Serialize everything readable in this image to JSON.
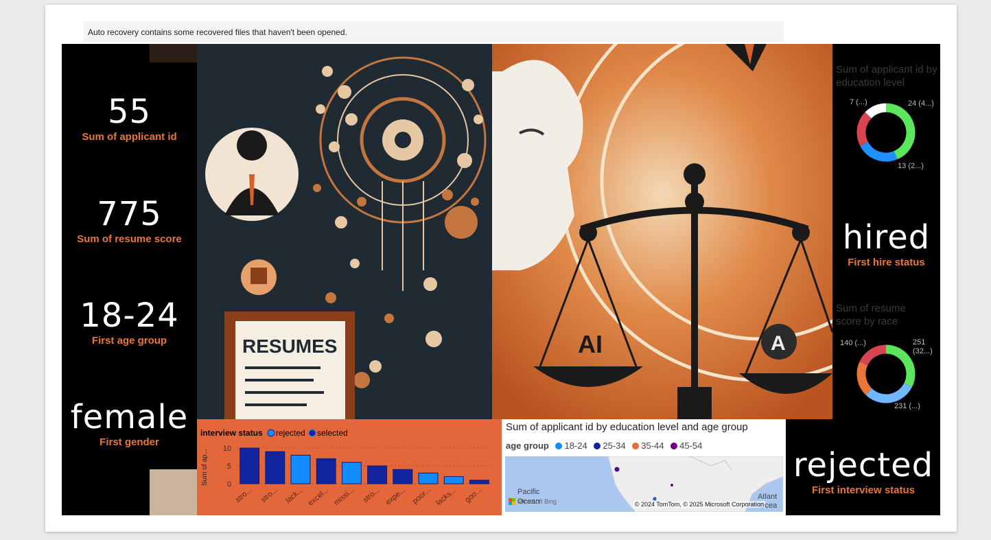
{
  "notification": "Auto recovery contains some recovered files that haven't been opened.",
  "kpis": [
    {
      "value": "55",
      "label": "Sum of applicant id"
    },
    {
      "value": "775",
      "label": "Sum of resume score"
    },
    {
      "value": "18-24",
      "label": "First age group"
    },
    {
      "value": "female",
      "label": "First gender"
    }
  ],
  "kpis_right": [
    {
      "value": "hired",
      "label": "First hire status"
    },
    {
      "value": "rejected",
      "label": "First interview status"
    }
  ],
  "hero": {
    "resume_text": "RESUMES",
    "ai_text": "AI",
    "a_text": "A"
  },
  "colors": {
    "accent": "#e8763b",
    "panel_orange": "#e3673a",
    "navy": "#12239e",
    "blue": "#118dff",
    "green": "#5ce65c",
    "red": "#d64550"
  },
  "chart_data": [
    {
      "type": "pie",
      "title": "Sum of applicant id by education level",
      "donut": true,
      "slices": [
        {
          "value": 24,
          "label": "24 (4...)",
          "color": "#5ce65c"
        },
        {
          "value": 13,
          "label": "13 (2...)",
          "color": "#1e90ff"
        },
        {
          "value": 11,
          "label": "",
          "color": "#d64550"
        },
        {
          "value": 7,
          "label": "7 (...)",
          "color": "#ffffff"
        }
      ]
    },
    {
      "type": "pie",
      "title": "Sum of resume score by race",
      "donut": true,
      "slices": [
        {
          "value": 251,
          "label": "251 (32...)",
          "color": "#5ce65c"
        },
        {
          "value": 231,
          "label": "231 (...)",
          "color": "#6fb7ff"
        },
        {
          "value": 153,
          "label": "",
          "color": "#e8763b"
        },
        {
          "value": 140,
          "label": "140 (...)",
          "color": "#d64550"
        }
      ]
    },
    {
      "type": "bar",
      "legend_title": "interview status",
      "legend": [
        {
          "name": "rejected",
          "color": "#118dff"
        },
        {
          "name": "selected",
          "color": "#12239e"
        }
      ],
      "ylabel": "Sum of ap...",
      "ylim": [
        0,
        10
      ],
      "yticks": [
        0,
        5,
        10
      ],
      "categories": [
        "stro...",
        "stro...",
        "lack...",
        "excel...",
        "missi...",
        "stro...",
        "expe...",
        "poor...",
        "lacks...",
        "goo..."
      ],
      "values": [
        10,
        9,
        8,
        7,
        6,
        5,
        4,
        3,
        2,
        1
      ],
      "bar_status": [
        "selected",
        "selected",
        "rejected",
        "selected",
        "rejected",
        "selected",
        "selected",
        "rejected",
        "rejected",
        "selected"
      ]
    },
    {
      "type": "map",
      "title": "Sum of applicant id by education level and age group",
      "legend_title": "age group",
      "legend": [
        {
          "name": "18-24",
          "color": "#118dff"
        },
        {
          "name": "25-34",
          "color": "#12239e"
        },
        {
          "name": "35-44",
          "color": "#e66c37"
        },
        {
          "name": "45-54",
          "color": "#6b007b"
        }
      ],
      "labels": {
        "pacific": "Pacific",
        "ocean": "Ocean",
        "atlantic": "Atlant",
        "ocean2": "Ocea",
        "microsoft": "Microsoft Bing"
      },
      "copyright": "© 2024 TomTom, © 2025 Microsoft Corporation"
    }
  ]
}
